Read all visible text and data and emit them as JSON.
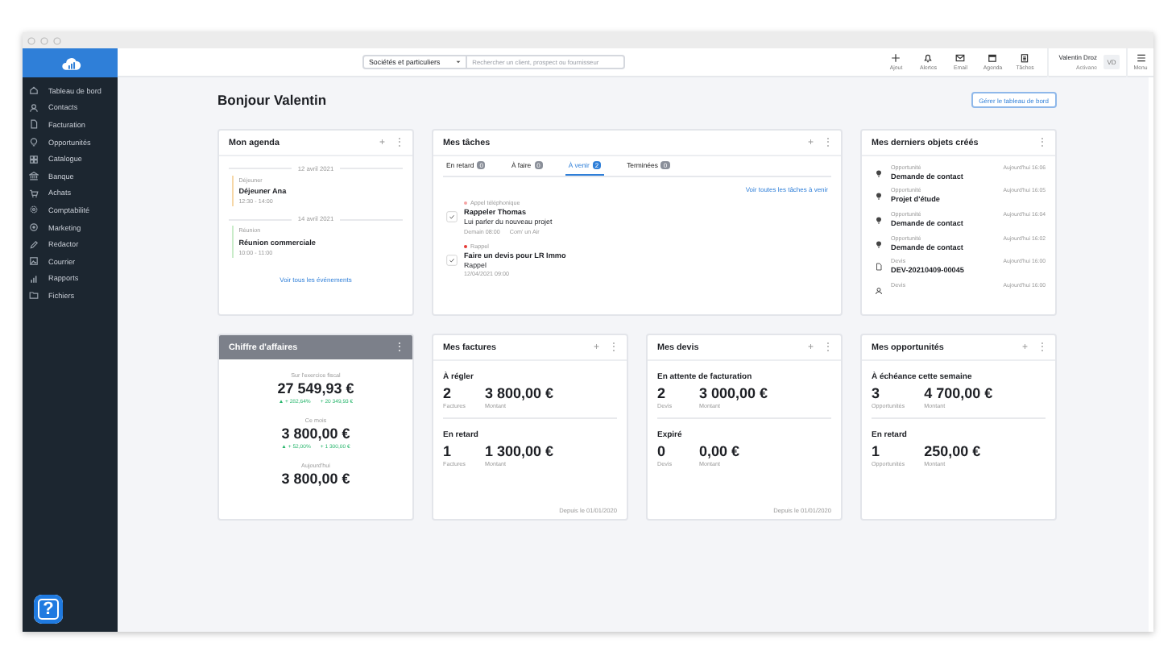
{
  "sidebar": {
    "items": [
      {
        "label": "Tableau de bord",
        "selected": false
      },
      {
        "label": "Contacts",
        "selected": false
      },
      {
        "label": "Facturation",
        "selected": false
      },
      {
        "label": "Opportunités",
        "selected": false
      },
      {
        "label": "Catalogue",
        "selected": false
      },
      {
        "label": "Banque",
        "selected": false
      },
      {
        "label": "Achats",
        "selected": false
      },
      {
        "label": "Comptabilité",
        "selected": false
      },
      {
        "label": "Marketing",
        "selected": false
      },
      {
        "label": "Redactor",
        "selected": false
      },
      {
        "label": "Courrier",
        "selected": false
      },
      {
        "label": "Rapports",
        "selected": false
      },
      {
        "label": "Fichiers",
        "selected": false
      }
    ],
    "help": "?"
  },
  "topbar": {
    "scope": "Sociétés et particuliers",
    "search": {
      "placeholder": "Rechercher un client, prospect ou fournisseur"
    },
    "actions": [
      "Ajout",
      "Alertes",
      "Email",
      "Agenda",
      "Tâches"
    ],
    "user": {
      "name": "Valentin Droz",
      "company": "Activane",
      "initials": "VD"
    },
    "menu": "Menu"
  },
  "greeting": "Bonjour Valentin",
  "manage_button": "Gérer le tableau de bord",
  "agenda": {
    "title": "Mon agenda",
    "actions": [
      "+",
      "⋮"
    ],
    "days": [
      {
        "date": "12 avril 2021",
        "events": [
          {
            "type": "Déjeuner",
            "title": "Déjeuner Ana",
            "time": "12:30 - 14:00",
            "color": "#f6d7a7"
          }
        ]
      },
      {
        "date": "14 avril 2021",
        "events": [
          {
            "type": "Réunion",
            "title": "Réunion commerciale",
            "time": "10:00 - 11:00",
            "color": "#c9ecc9"
          }
        ]
      }
    ],
    "link": "Voir tous les événements"
  },
  "tasks": {
    "title": "Mes tâches",
    "actions": [
      "+",
      "⋮"
    ],
    "tabs": [
      {
        "label": "En retard",
        "count": "0",
        "selected": false
      },
      {
        "label": "À faire",
        "count": "0",
        "selected": false
      },
      {
        "label": "À venir",
        "count": "2",
        "selected": true
      },
      {
        "label": "Terminées",
        "count": "0",
        "selected": false
      }
    ],
    "link": "Voir toutes les tâches à venir",
    "items": [
      {
        "type": "Appel téléphonique",
        "color": "#f5a3a3",
        "title": "Rappeler Thomas",
        "description": "Lui parler du nouveau projet",
        "meta": [
          "Demain 08:00",
          "Com' un Air"
        ]
      },
      {
        "type": "Rappel",
        "color": "#e53935",
        "title": "Faire un devis pour LR Immo",
        "description": "Rappel",
        "meta": [
          "12/04/2021 09:00"
        ]
      }
    ]
  },
  "recent": {
    "title": "Mes derniers objets créés",
    "actions": [
      "⋮"
    ],
    "items": [
      {
        "kind": "opportunity",
        "type": "Opportunité",
        "title": "Demande de contact",
        "time": "Aujourd'hui 16:06"
      },
      {
        "kind": "opportunity",
        "type": "Opportunité",
        "title": "Projet d'étude",
        "time": "Aujourd'hui 16:05"
      },
      {
        "kind": "opportunity",
        "type": "Opportunité",
        "title": "Demande de contact",
        "time": "Aujourd'hui 16:04"
      },
      {
        "kind": "opportunity",
        "type": "Opportunité",
        "title": "Demande de contact",
        "time": "Aujourd'hui 16:02"
      },
      {
        "kind": "quote",
        "type": "Devis",
        "title": "DEV-20210409-00045",
        "time": "Aujourd'hui 16:00"
      },
      {
        "kind": "contact",
        "type": "Devis",
        "time": "Aujourd'hui 16:00"
      }
    ]
  },
  "revenue": {
    "title": "Chiffre d'affaires",
    "actions": [
      "⋮"
    ],
    "blocks": [
      {
        "label": "Sur l'exercice fiscal",
        "value": "27 549,93 €",
        "changes": [
          "▲ + 282,64%",
          "+ 20 349,93 €"
        ]
      },
      {
        "label": "Ce mois",
        "value": "3 800,00 €",
        "changes": [
          "▲ + 52,00%",
          "+ 1 300,00 €"
        ]
      },
      {
        "label": "Aujourd'hui",
        "value": "3 800,00 €"
      }
    ]
  },
  "stat_cards": [
    {
      "title": "Mes factures",
      "actions": [
        "+",
        "⋮"
      ],
      "sections": [
        {
          "title": "À régler",
          "stats": [
            {
              "value": "2",
              "label": "Factures"
            },
            {
              "value": "3 800,00 €",
              "label": "Montant"
            }
          ]
        },
        {
          "title": "En retard",
          "stats": [
            {
              "value": "1",
              "label": "Factures"
            },
            {
              "value": "1 300,00 €",
              "label": "Montant"
            }
          ]
        }
      ],
      "footer": "Depuis le 01/01/2020"
    },
    {
      "title": "Mes devis",
      "actions": [
        "+",
        "⋮"
      ],
      "sections": [
        {
          "title": "En attente de facturation",
          "stats": [
            {
              "value": "2",
              "label": "Devis"
            },
            {
              "value": "3 000,00 €",
              "label": "Montant"
            }
          ]
        },
        {
          "title": "Expiré",
          "stats": [
            {
              "value": "0",
              "label": "Devis"
            },
            {
              "value": "0,00 €",
              "label": "Montant"
            }
          ]
        }
      ],
      "footer": "Depuis le 01/01/2020"
    },
    {
      "title": "Mes opportunités",
      "actions": [
        "+",
        "⋮"
      ],
      "sections": [
        {
          "title": "À échéance cette semaine",
          "stats": [
            {
              "value": "3",
              "label": "Opportunités"
            },
            {
              "value": "4 700,00 €",
              "label": "Montant"
            }
          ]
        },
        {
          "title": "En retard",
          "stats": [
            {
              "value": "1",
              "label": "Opportunités"
            },
            {
              "value": "250,00 €",
              "label": "Montant"
            }
          ]
        }
      ]
    }
  ]
}
